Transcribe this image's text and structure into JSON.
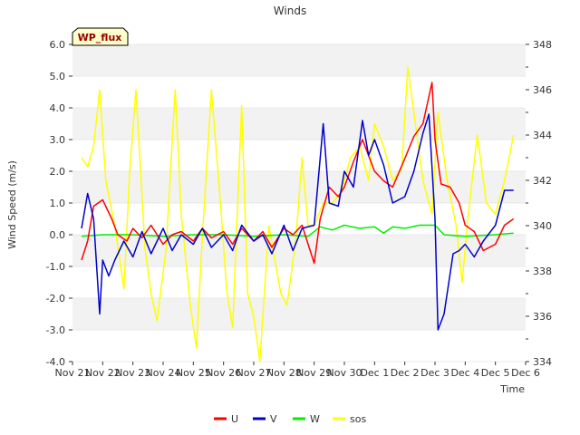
{
  "chart_data": {
    "type": "line",
    "title": "Winds",
    "xlabel": "Time",
    "ylabel": "Wind Speed (m/s)",
    "site_label": "WP_flux",
    "xlim": [
      0,
      15
    ],
    "ylim": [
      -4.0,
      6.0
    ],
    "y2lim": [
      334,
      348
    ],
    "x_tick_labels": [
      "Nov 21",
      "Nov 22",
      "Nov 23",
      "Nov 24",
      "Nov 25",
      "Nov 26",
      "Nov 27",
      "Nov 28",
      "Nov 29",
      "Nov 30",
      "Dec 1",
      "Dec 2",
      "Dec 3",
      "Dec 4",
      "Dec 5",
      "Dec 6"
    ],
    "y_tick_labels": [
      "-4.0",
      "-3.0",
      "-2.0",
      "-1.0",
      "0.0",
      "1.0",
      "2.0",
      "3.0",
      "4.0",
      "5.0",
      "6.0"
    ],
    "y2_tick_labels": [
      "334",
      "336",
      "338",
      "340",
      "342",
      "344",
      "346",
      "348"
    ],
    "legend": [
      "U",
      "V",
      "W",
      "sos"
    ],
    "legend_position": "bottom-center",
    "grid": "horizontal bands",
    "colors": {
      "U": "#ff0000",
      "V": "#0000cc",
      "W": "#00ee00",
      "sos": "#ffff00",
      "band": "#f2f2f2",
      "gridline": "#d8d8d8",
      "label_box": "#ffffcc",
      "label_text": "#990000"
    },
    "series": [
      {
        "name": "U",
        "axis": "left",
        "x": [
          0.3,
          0.5,
          0.7,
          1.0,
          1.3,
          1.5,
          1.8,
          2.0,
          2.3,
          2.6,
          3.0,
          3.3,
          3.6,
          4.0,
          4.3,
          4.6,
          5.0,
          5.3,
          5.6,
          6.0,
          6.3,
          6.6,
          7.0,
          7.3,
          7.6,
          8.0,
          8.2,
          8.5,
          8.8,
          9.0,
          9.3,
          9.6,
          10.0,
          10.3,
          10.6,
          11.0,
          11.3,
          11.6,
          11.9,
          12.0,
          12.2,
          12.5,
          12.8,
          13.0,
          13.3,
          13.6,
          14.0,
          14.3,
          14.6
        ],
        "values": [
          -0.8,
          -0.2,
          0.9,
          1.1,
          0.5,
          0.0,
          -0.2,
          0.2,
          -0.1,
          0.3,
          -0.3,
          0.0,
          0.1,
          -0.2,
          0.2,
          -0.1,
          0.1,
          -0.3,
          0.2,
          -0.2,
          0.1,
          -0.4,
          0.2,
          0.0,
          0.3,
          -0.9,
          0.5,
          1.5,
          1.2,
          1.5,
          2.3,
          3.0,
          2.0,
          1.7,
          1.5,
          2.4,
          3.1,
          3.5,
          4.8,
          3.0,
          1.6,
          1.5,
          1.0,
          0.3,
          0.1,
          -0.5,
          -0.3,
          0.3,
          0.5
        ]
      },
      {
        "name": "V",
        "axis": "left",
        "x": [
          0.3,
          0.5,
          0.7,
          0.9,
          1.0,
          1.2,
          1.4,
          1.7,
          2.0,
          2.3,
          2.6,
          3.0,
          3.3,
          3.6,
          4.0,
          4.3,
          4.6,
          5.0,
          5.3,
          5.6,
          6.0,
          6.3,
          6.6,
          7.0,
          7.3,
          7.6,
          8.0,
          8.3,
          8.5,
          8.8,
          9.0,
          9.3,
          9.6,
          9.8,
          10.0,
          10.3,
          10.6,
          11.0,
          11.3,
          11.6,
          11.8,
          12.0,
          12.1,
          12.3,
          12.6,
          12.8,
          13.0,
          13.3,
          13.6,
          14.0,
          14.3,
          14.6
        ],
        "values": [
          0.2,
          1.3,
          0.5,
          -2.5,
          -0.8,
          -1.3,
          -0.8,
          -0.2,
          -0.7,
          0.1,
          -0.6,
          0.2,
          -0.5,
          0.0,
          -0.3,
          0.2,
          -0.4,
          0.0,
          -0.5,
          0.3,
          -0.2,
          0.0,
          -0.6,
          0.3,
          -0.5,
          0.2,
          0.3,
          3.5,
          1.0,
          0.9,
          2.0,
          1.5,
          3.6,
          2.5,
          3.0,
          2.2,
          1.0,
          1.2,
          2.0,
          3.2,
          3.8,
          0.5,
          -3.0,
          -2.5,
          -0.6,
          -0.5,
          -0.3,
          -0.7,
          -0.2,
          0.3,
          1.4,
          1.4
        ]
      },
      {
        "name": "W",
        "axis": "left",
        "x": [
          0.3,
          1.0,
          2.0,
          3.0,
          4.0,
          5.0,
          6.0,
          7.0,
          7.8,
          8.2,
          8.6,
          9.0,
          9.5,
          10.0,
          10.3,
          10.6,
          11.0,
          11.5,
          12.0,
          12.3,
          13.0,
          14.0,
          14.6
        ],
        "values": [
          -0.05,
          0.0,
          0.0,
          -0.05,
          0.0,
          0.0,
          -0.05,
          0.0,
          -0.05,
          0.25,
          0.15,
          0.3,
          0.2,
          0.25,
          0.05,
          0.25,
          0.2,
          0.3,
          0.3,
          0.0,
          -0.05,
          0.0,
          0.05
        ]
      },
      {
        "name": "sos",
        "axis": "right",
        "x": [
          0.3,
          0.5,
          0.7,
          0.9,
          1.1,
          1.4,
          1.7,
          1.9,
          2.1,
          2.4,
          2.6,
          2.8,
          3.1,
          3.4,
          3.6,
          3.9,
          4.1,
          4.3,
          4.6,
          4.9,
          5.1,
          5.3,
          5.6,
          5.8,
          6.0,
          6.2,
          6.5,
          6.7,
          6.9,
          7.1,
          7.4,
          7.6,
          7.8,
          8.0,
          8.3,
          8.6,
          8.9,
          9.2,
          9.5,
          9.8,
          10.0,
          10.3,
          10.6,
          10.9,
          11.1,
          11.3,
          11.6,
          11.9,
          12.1,
          12.4,
          12.7,
          12.9,
          13.1,
          13.4,
          13.7,
          14.0,
          14.3,
          14.6
        ],
        "values": [
          343.0,
          342.6,
          343.5,
          346.0,
          342.0,
          340.0,
          337.2,
          342.5,
          346.0,
          339.0,
          337.0,
          335.8,
          339.0,
          346.0,
          340.5,
          336.5,
          334.6,
          339.5,
          346.0,
          341.0,
          337.2,
          335.5,
          345.3,
          337.0,
          336.0,
          334.0,
          340.0,
          338.5,
          337.0,
          336.5,
          339.5,
          343.0,
          340.0,
          340.0,
          341.0,
          341.0,
          341.5,
          343.0,
          343.5,
          342.0,
          344.5,
          343.5,
          342.0,
          342.5,
          347.0,
          345.0,
          342.0,
          340.5,
          345.0,
          342.0,
          340.0,
          337.5,
          340.5,
          344.0,
          341.0,
          340.5,
          342.0,
          344.0
        ]
      }
    ]
  }
}
